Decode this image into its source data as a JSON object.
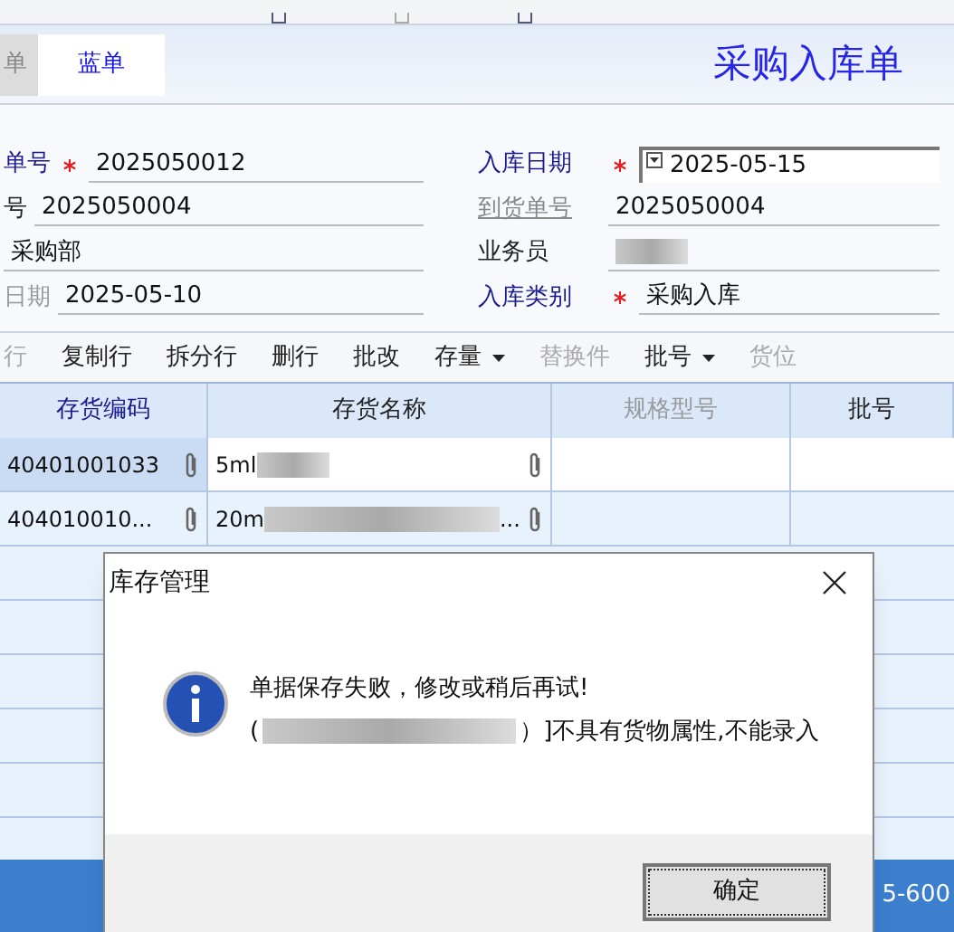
{
  "header": {
    "tabs": [
      {
        "label": "单",
        "selected": false
      },
      {
        "label": "蓝单",
        "selected": true
      }
    ],
    "title": "采购入库单"
  },
  "form": {
    "left": [
      {
        "label": "单号",
        "required": true,
        "value": "2025050012",
        "kind": "text"
      },
      {
        "label": "号",
        "required": false,
        "value": "2025050004",
        "kind": "text"
      },
      {
        "required": false,
        "value": "采购部",
        "kind": "text"
      },
      {
        "label": "日期",
        "required": false,
        "value": "2025-05-10",
        "kind": "muted"
      }
    ],
    "right": [
      {
        "label": "入库日期",
        "required": true,
        "value": "2025-05-15",
        "kind": "date"
      },
      {
        "label": "到货单号",
        "required": false,
        "value": "2025050004",
        "kind": "link"
      },
      {
        "label": "业务员",
        "required": false,
        "kind": "redacted"
      },
      {
        "label": "入库类别",
        "required": true,
        "value": "采购入库",
        "kind": "text"
      }
    ]
  },
  "row_toolbar": [
    {
      "label": "行",
      "disabled": true,
      "kind": "plain"
    },
    {
      "label": "复制行",
      "disabled": false,
      "kind": "plain"
    },
    {
      "label": "拆分行",
      "disabled": false,
      "kind": "plain"
    },
    {
      "label": "删行",
      "disabled": false,
      "kind": "plain"
    },
    {
      "label": "批改",
      "disabled": false,
      "kind": "plain"
    },
    {
      "label": "存量",
      "disabled": false,
      "kind": "dropdown"
    },
    {
      "label": "替换件",
      "disabled": true,
      "kind": "plain"
    },
    {
      "label": "批号",
      "disabled": false,
      "kind": "dropdown"
    },
    {
      "label": "货位",
      "disabled": true,
      "kind": "plain"
    }
  ],
  "table": {
    "columns": [
      {
        "label": "存货编码",
        "kind": "key"
      },
      {
        "label": "存货名称",
        "kind": "normal"
      },
      {
        "label": "规格型号",
        "kind": "muted"
      },
      {
        "label": "批号",
        "kind": "normal"
      }
    ],
    "rows": [
      {
        "selected": true,
        "code": "40401001033",
        "name": "5ml",
        "name_tail": ""
      },
      {
        "selected": false,
        "code": "404010010...",
        "name": "20m",
        "name_tail": "..."
      }
    ]
  },
  "status_bar": {
    "text": "5-600"
  },
  "dialog": {
    "title": "库存管理",
    "message": "单据保存失败，修改或稍后再试!",
    "detail_start": "(",
    "detail_end": "）]不具有货物属性,不能录入",
    "ok": "确定"
  }
}
